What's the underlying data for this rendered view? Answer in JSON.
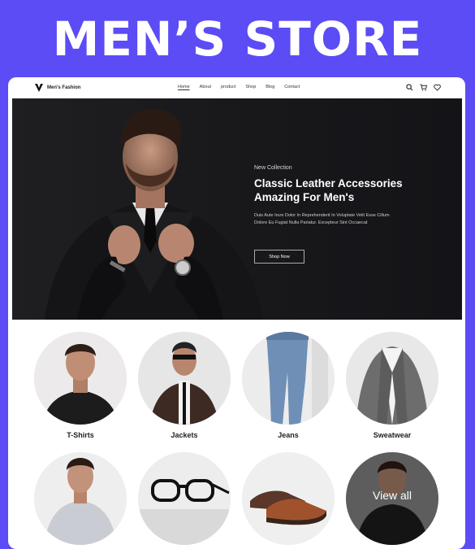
{
  "banner": {
    "title": "MEN’S STORE"
  },
  "nav": {
    "brand": "Men's Fashion",
    "items": [
      {
        "label": "Home",
        "active": true
      },
      {
        "label": "About",
        "active": false
      },
      {
        "label": "product",
        "active": false
      },
      {
        "label": "Shop",
        "active": false
      },
      {
        "label": "Blog",
        "active": false
      },
      {
        "label": "Contact",
        "active": false
      }
    ],
    "icons": [
      "search-icon",
      "cart-icon",
      "heart-icon"
    ]
  },
  "hero": {
    "tag": "New Collection",
    "heading_line1": "Classic Leather Accessories",
    "heading_line2": "Amazing For Men's",
    "desc_line1": "Duis Aute Irure Dolor In Reprehenderit In Voluptate Velit Esse Cillum",
    "desc_line2": "Dolore Eu Fugiat Nulla Pariatur. Excepteur Sint Occaecat",
    "button": "Shop Now"
  },
  "categories": [
    {
      "label": "T-Shirts"
    },
    {
      "label": "Jackets"
    },
    {
      "label": "Jeans"
    },
    {
      "label": "Sweatwear"
    },
    {
      "label": ""
    },
    {
      "label": ""
    },
    {
      "label": ""
    },
    {
      "label": "View all"
    }
  ],
  "colors": {
    "background": "#5b4cf5",
    "hero": "#1b1b1e"
  }
}
